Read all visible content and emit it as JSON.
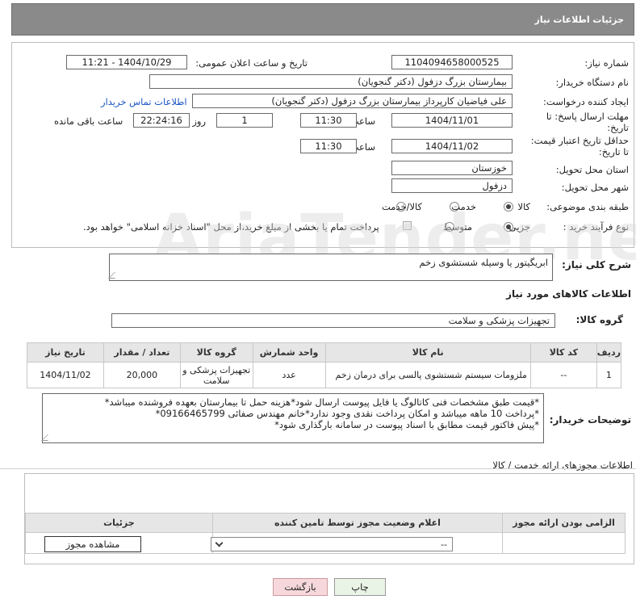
{
  "header": {
    "title": "جزئیات اطلاعات نیاز"
  },
  "form": {
    "need_number_label": "شماره نیاز:",
    "need_number": "1104094658000525",
    "announce_label": "تاریخ و ساعت اعلان عمومی:",
    "announce_value": "1404/10/29 - 11:21",
    "buyer_org_label": "نام دستگاه خریدار:",
    "buyer_org": "بیمارستان بزرگ دزفول (دکتر گنجویان)",
    "requester_label": "ایجاد کننده درخواست:",
    "requester": "علی فیاضیان کارپرداز بیمارستان بزرگ دزفول (دکتر گنجویان)",
    "contact_link": "اطلاعات تماس خریدار",
    "reply_deadline_label": "مهلت ارسال پاسخ: تا تاریخ:",
    "reply_date": "1404/11/01",
    "time_label": "ساعت",
    "reply_time": "11:30",
    "days_value": "1",
    "days_label": "روز و",
    "remaining_time": "22:24:16",
    "remaining_label": "ساعت باقی مانده",
    "price_validity_label": "حداقل تاریخ اعتبار قیمت: تا تاریخ:",
    "price_date": "1404/11/02",
    "price_time": "11:30",
    "province_label": "استان محل تحویل:",
    "province": "خوزستان",
    "city_label": "شهر محل تحویل:",
    "city": "دزفول",
    "category_label": "طبقه بندی موضوعی:",
    "category_options": [
      "کالا",
      "خدمت",
      "کالا/خدمت"
    ],
    "process_label": "نوع فرآیند خرید :",
    "process_options": [
      "جزیی",
      "متوسط"
    ],
    "payment_note": "پرداخت تمام یا بخشی از مبلغ خرید،از محل \"اسناد خزانه اسلامی\" خواهد بود."
  },
  "summary": {
    "label": "شرح کلی نیاز:",
    "value": "ابریگیتور یا وسیله شستشوی زخم"
  },
  "goods": {
    "section_title": "اطلاعات کالاهای مورد نیاز",
    "group_label": "گروه کالا:",
    "group_value": "تجهیزات پزشکی و سلامت",
    "columns": [
      "ردیف",
      "کد کالا",
      "نام کالا",
      "واحد شمارش",
      "گروه کالا",
      "تعداد / مقدار",
      "تاریخ نیاز"
    ],
    "rows": [
      {
        "row": "1",
        "code": "--",
        "name": "ملزومات سیستم شستشوی پالسی برای درمان زخم",
        "unit": "عدد",
        "group": "تجهیزات پزشکی و سلامت",
        "qty": "20,000",
        "date": "1404/11/02"
      }
    ]
  },
  "buyer_notes": {
    "label": "توضیحات خریدار:",
    "lines": [
      "*قیمت طبق مشخصات فنی کاتالوگ یا فایل پیوست ارسال شود*هزینه حمل تا بیمارستان بعهده فروشنده میباشد*",
      "*پرداخت 10 ماهه میباشد و امکان پرداخت نقدی وجود ندارد*خانم مهندس صفائی 09166465799*",
      "*پیش فاکتور قیمت مطابق با اسناد پیوست در سامانه بارگذاری شود*"
    ]
  },
  "permits": {
    "section_title": "اطلاعات مجوزهای ارائه خدمت / کالا",
    "columns": [
      "الزامی بودن ارائه مجوز",
      "اعلام وضعیت مجوز توسط تامین کننده",
      "جزئیات"
    ],
    "select_value": "--",
    "view_button": "مشاهده مجوز"
  },
  "actions": {
    "print": "چاپ",
    "back": "بازگشت"
  },
  "watermark": "AriaTender.neT"
}
